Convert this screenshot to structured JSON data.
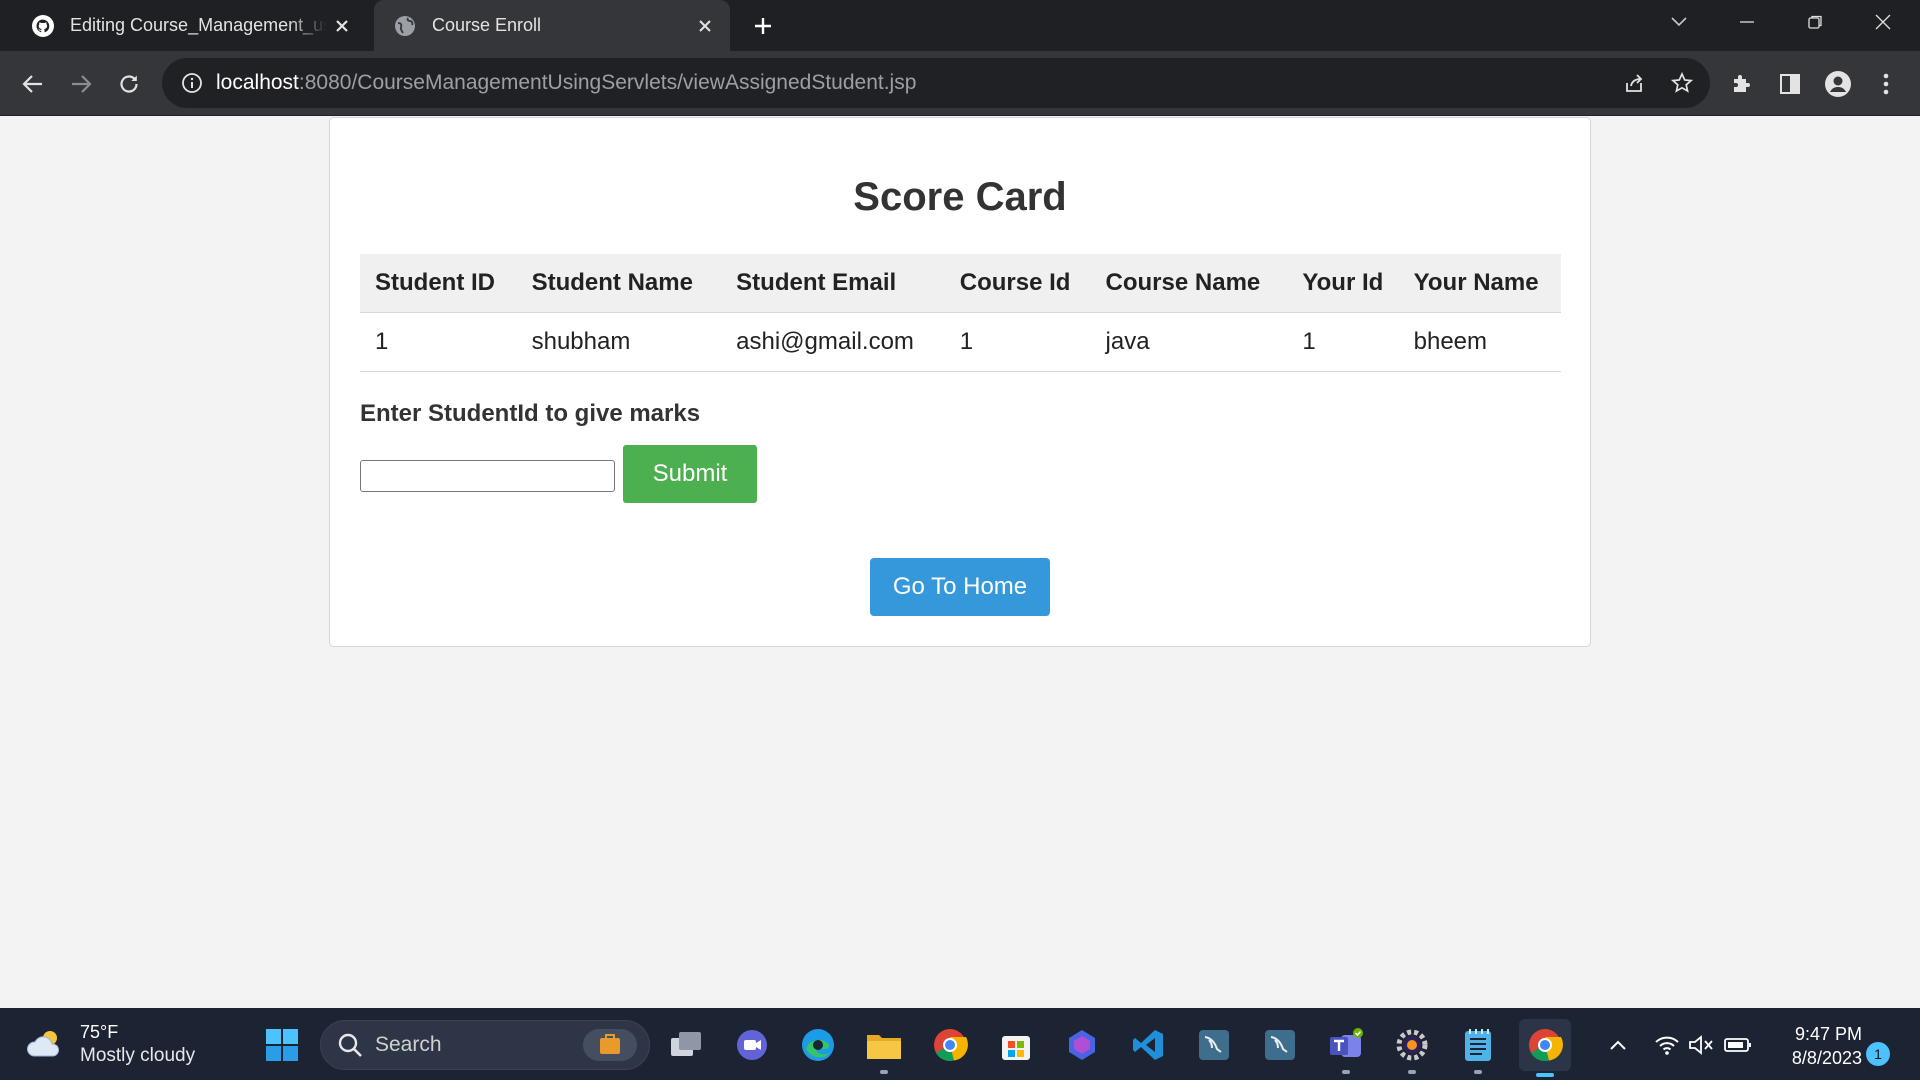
{
  "browser": {
    "tabs": [
      {
        "title": "Editing Course_Management_using",
        "favicon": "github-icon",
        "active": false
      },
      {
        "title": "Course Enroll",
        "favicon": "globe-icon",
        "active": true
      }
    ],
    "url_host": "localhost",
    "url_rest": ":8080/CourseManagementUsingServlets/viewAssignedStudent.jsp"
  },
  "page": {
    "title": "Score Card",
    "table": {
      "headers": [
        "Student ID",
        "Student Name",
        "Student Email",
        "Course Id",
        "Course Name",
        "Your Id",
        "Your Name"
      ],
      "rows": [
        [
          "1",
          "shubham",
          "ashi@gmail.com",
          "1",
          "java",
          "1",
          "bheem"
        ]
      ]
    },
    "marks_label": "Enter StudentId to give marks",
    "student_id_value": "",
    "submit_label": "Submit",
    "home_label": "Go To Home",
    "colors": {
      "submit": "#4caf50",
      "home": "#3498db"
    }
  },
  "taskbar": {
    "weather_temp": "75°F",
    "weather_desc": "Mostly cloudy",
    "search_placeholder": "Search",
    "time": "9:47 PM",
    "date": "8/8/2023",
    "notification_count": "1"
  }
}
